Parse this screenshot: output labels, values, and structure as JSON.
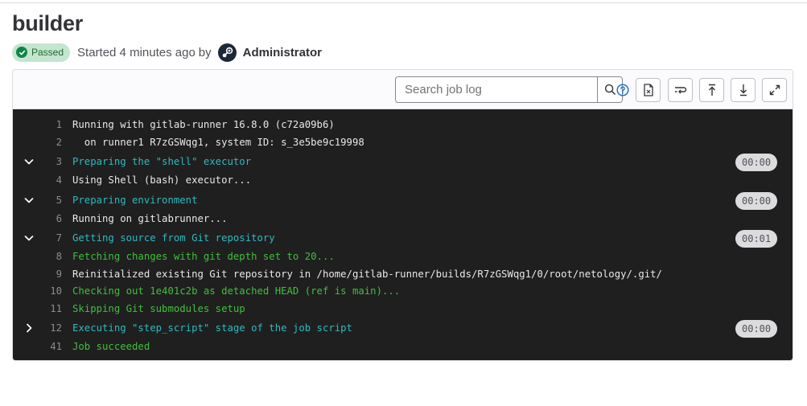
{
  "job": {
    "title": "builder",
    "status": "Passed",
    "started_text": "Started 4 minutes ago",
    "by": "by",
    "author": "Administrator",
    "colors": {
      "status_bg": "#c3e6cd",
      "status_fg": "#24663b",
      "status_icon": "#108548"
    }
  },
  "toolbar": {
    "search_placeholder": "Search job log",
    "buttons": [
      "search-icon",
      "help-icon",
      "raw-log-icon",
      "wrap-lines-icon",
      "scroll-top-icon",
      "scroll-bottom-icon",
      "fullscreen-icon"
    ]
  },
  "log": {
    "colors": {
      "background": "#1f1f1f",
      "default": "#e8e8e8",
      "cyan": "#2fbac0",
      "green": "#3fc03a"
    },
    "lines": [
      {
        "n": "1",
        "text": "Running with gitlab-runner 16.8.0 (c72a09b6)",
        "color": "default"
      },
      {
        "n": "2",
        "text": "  on runner1 R7zGSWqg1, system ID: s_3e5be9c19998",
        "color": "default"
      },
      {
        "n": "3",
        "text": "Preparing the \"shell\" executor",
        "color": "cyan",
        "toggle": "expanded",
        "duration": "00:00"
      },
      {
        "n": "4",
        "text": "Using Shell (bash) executor...",
        "color": "default"
      },
      {
        "n": "5",
        "text": "Preparing environment",
        "color": "cyan",
        "toggle": "expanded",
        "duration": "00:00"
      },
      {
        "n": "6",
        "text": "Running on gitlabrunner...",
        "color": "default"
      },
      {
        "n": "7",
        "text": "Getting source from Git repository",
        "color": "cyan",
        "toggle": "expanded",
        "duration": "00:01"
      },
      {
        "n": "8",
        "text": "Fetching changes with git depth set to 20...",
        "color": "green"
      },
      {
        "n": "9",
        "text": "Reinitialized existing Git repository in /home/gitlab-runner/builds/R7zGSWqg1/0/root/netology/.git/",
        "color": "default"
      },
      {
        "n": "10",
        "text": "Checking out 1e401c2b as detached HEAD (ref is main)...",
        "color": "green"
      },
      {
        "n": "11",
        "text": "Skipping Git submodules setup",
        "color": "green"
      },
      {
        "n": "12",
        "text": "Executing \"step_script\" stage of the job script",
        "color": "cyan",
        "toggle": "collapsed",
        "duration": "00:00"
      },
      {
        "n": "41",
        "text": "Job succeeded",
        "color": "green"
      }
    ]
  }
}
